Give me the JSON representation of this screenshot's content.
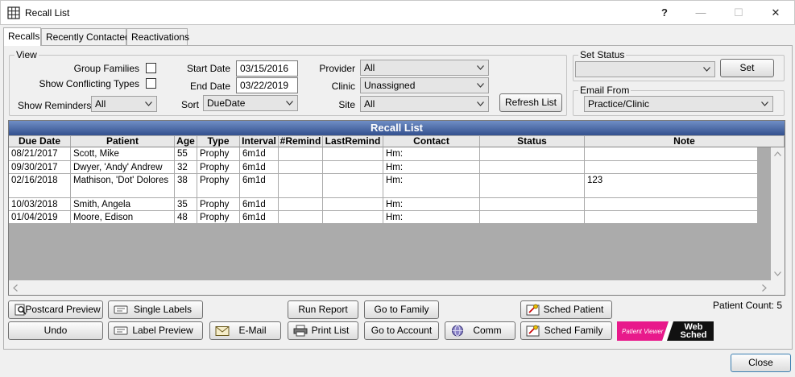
{
  "window": {
    "title": "Recall List",
    "help": "?",
    "minimize": "—",
    "maximize": "☐",
    "close": "✕"
  },
  "tabs": [
    {
      "label": "Recalls"
    },
    {
      "label": "Recently Contacted"
    },
    {
      "label": "Reactivations"
    }
  ],
  "view": {
    "label": "View",
    "group_families": "Group Families",
    "show_conflicting_types": "Show Conflicting Types",
    "show_reminders_label": "Show Reminders",
    "show_reminders_value": "All",
    "start_date_label": "Start Date",
    "start_date_value": "03/15/2016",
    "end_date_label": "End Date",
    "end_date_value": "03/22/2019",
    "sort_label": "Sort",
    "sort_value": "DueDate",
    "provider_label": "Provider",
    "provider_value": "All",
    "clinic_label": "Clinic",
    "clinic_value": "Unassigned",
    "site_label": "Site",
    "site_value": "All",
    "refresh_label": "Refresh List"
  },
  "set_status": {
    "label": "Set Status",
    "value": "",
    "button": "Set"
  },
  "email_from": {
    "label": "Email From",
    "value": "Practice/Clinic"
  },
  "grid": {
    "title": "Recall List",
    "columns": [
      "Due Date",
      "Patient",
      "Age",
      "Type",
      "Interval",
      "#Remind",
      "LastRemind",
      "Contact",
      "Status",
      "Note"
    ],
    "rows": [
      {
        "due": "08/21/2017",
        "patient": "Scott, Mike",
        "age": "55",
        "type": "Prophy",
        "interval": "6m1d",
        "remind": "",
        "last": "",
        "contact": "Hm:",
        "status": "",
        "note": ""
      },
      {
        "due": "09/30/2017",
        "patient": "Dwyer, 'Andy' Andrew",
        "age": "32",
        "type": "Prophy",
        "interval": "6m1d",
        "remind": "",
        "last": "",
        "contact": "Hm:",
        "status": "",
        "note": ""
      },
      {
        "due": "02/16/2018",
        "patient": "Mathison, 'Dot' Dolores",
        "age": "38",
        "type": "Prophy",
        "interval": "6m1d",
        "remind": "",
        "last": "",
        "contact": "Hm:",
        "status": "",
        "note": "123"
      },
      {
        "due": "10/03/2018",
        "patient": "Smith, Angela",
        "age": "35",
        "type": "Prophy",
        "interval": "6m1d",
        "remind": "",
        "last": "",
        "contact": "Hm:",
        "status": "",
        "note": ""
      },
      {
        "due": "01/04/2019",
        "patient": "Moore, Edison",
        "age": "48",
        "type": "Prophy",
        "interval": "6m1d",
        "remind": "",
        "last": "",
        "contact": "Hm:",
        "status": "",
        "note": ""
      }
    ]
  },
  "buttons": {
    "postcard_preview": "Postcard Preview",
    "single_labels": "Single Labels",
    "run_report": "Run Report",
    "go_to_family": "Go to Family",
    "sched_patient": "Sched Patient",
    "undo": "Undo",
    "label_preview": "Label Preview",
    "email": "E-Mail",
    "print_list": "Print List",
    "go_to_account": "Go to Account",
    "comm": "Comm",
    "sched_family": "Sched Family",
    "close": "Close"
  },
  "patient_viewer": {
    "left": "Patient Viewer",
    "right": "Web Sched"
  },
  "patient_count": "Patient Count: 5",
  "colors": {
    "grid_title_top": "#6f8ec5",
    "grid_title_bottom": "#33508e",
    "patient_viewer_pink": "#e8198b"
  }
}
